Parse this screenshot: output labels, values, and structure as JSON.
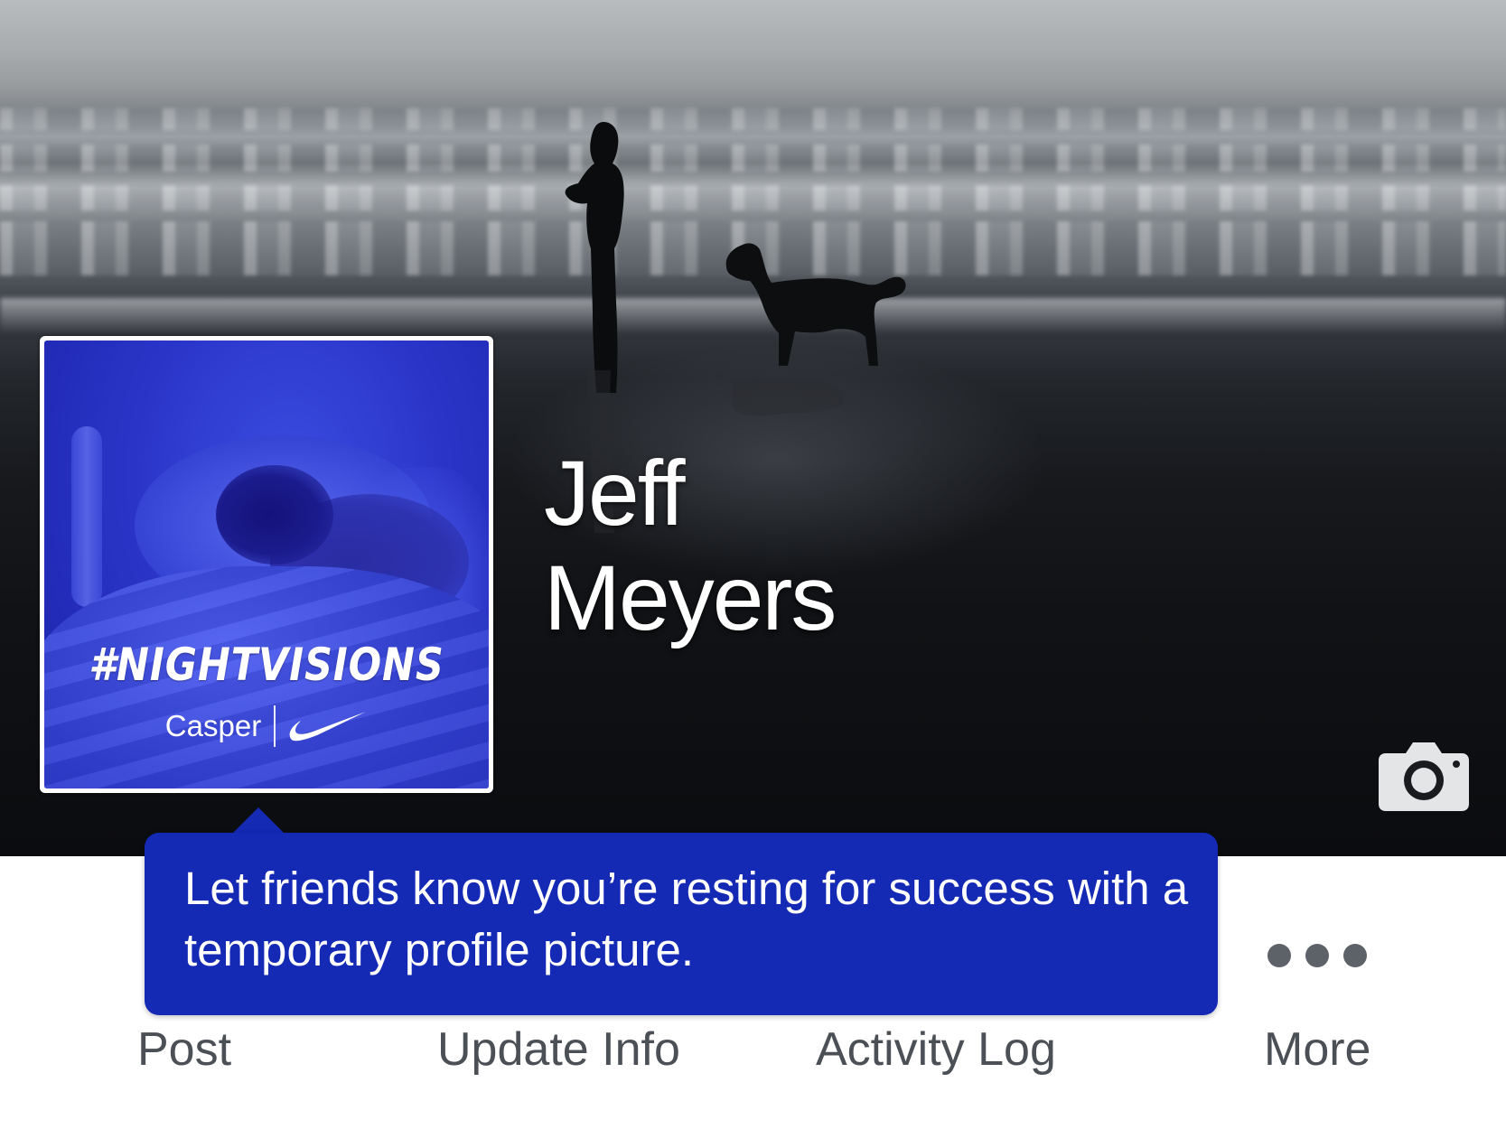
{
  "profile": {
    "first_name": "Jeff",
    "last_name": "Meyers"
  },
  "profile_picture": {
    "hashtag": "#NIGHTVISIONS",
    "brand_casper": "Casper",
    "brand_swoosh": "nike-swoosh-icon"
  },
  "tooltip": {
    "text": "Let friends know you’re resting for success with a temporary profile picture."
  },
  "actions": {
    "post_label": "Post",
    "update_info_label": "Update Info",
    "activity_log_label": "Activity Log",
    "more_label": "More"
  },
  "icons": {
    "camera": "camera-icon",
    "more": "more-dots-icon"
  },
  "colors": {
    "tooltip_bg": "#1429b4",
    "profile_pic_tint": "#2a35c8",
    "action_text": "#4b4f56"
  }
}
